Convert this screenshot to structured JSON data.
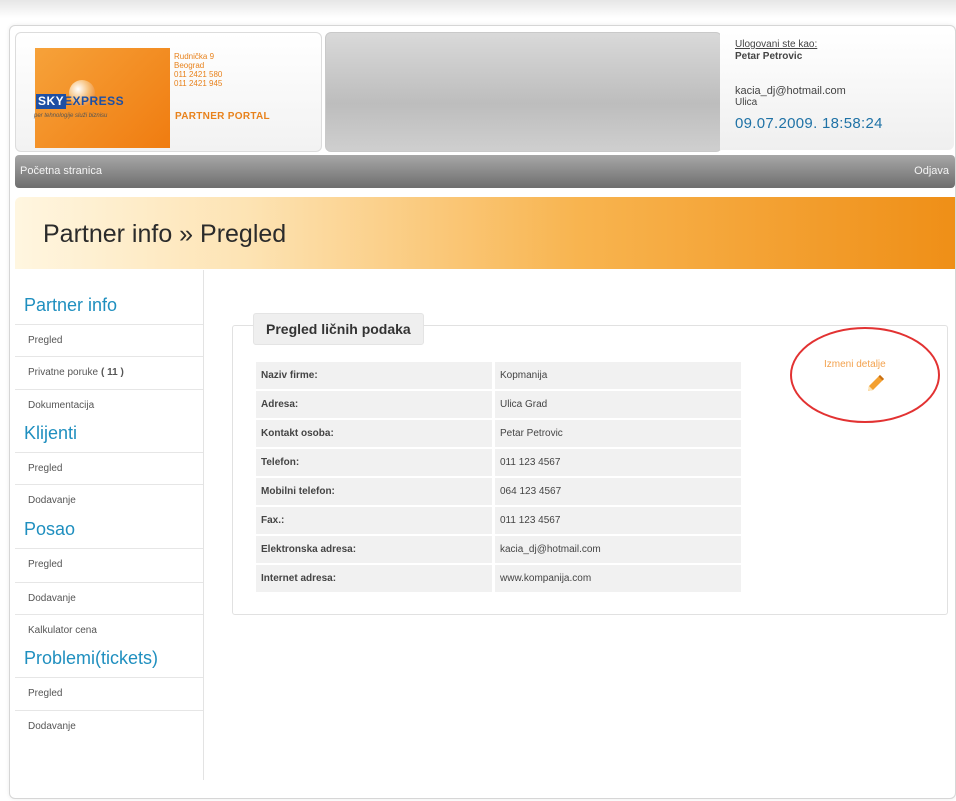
{
  "header": {
    "logo": {
      "sky": "SKY",
      "express": "EXPRESS",
      "tagline": "per tehnologije služi biznisu"
    },
    "contact": [
      "Rudnička 9",
      "Beograd",
      "011 2421 580",
      "011 2421 945"
    ],
    "portal_title": "PARTNER PORTAL",
    "user": {
      "label": "Ulogovani ste kao:",
      "name": "Petar Petrovic",
      "email": "kacia_dj@hotmail.com",
      "street": "Ulica",
      "datetime": "09.07.2009. 18:58:24"
    }
  },
  "nav": {
    "home": "Početna stranica",
    "logout": "Odjava"
  },
  "page_title": "Partner info » Pregled",
  "sidebar": {
    "sections": [
      {
        "title": "Partner info",
        "items": [
          {
            "label": "Pregled"
          },
          {
            "label": "Privatne poruke",
            "count": "( 11 )"
          },
          {
            "label": "Dokumentacija"
          }
        ]
      },
      {
        "title": "Klijenti",
        "items": [
          {
            "label": "Pregled"
          },
          {
            "label": "Dodavanje"
          }
        ]
      },
      {
        "title": "Posao",
        "items": [
          {
            "label": "Pregled"
          },
          {
            "label": "Dodavanje"
          },
          {
            "label": "Kalkulator cena"
          }
        ]
      },
      {
        "title": "Problemi(tickets)",
        "items": [
          {
            "label": "Pregled"
          },
          {
            "label": "Dodavanje"
          }
        ]
      }
    ]
  },
  "main": {
    "section_title": "Pregled ličnih podaka",
    "edit_label": "Izmeni detalje",
    "fields": [
      {
        "key": "Naziv firme:",
        "value": "Kopmanija"
      },
      {
        "key": "Adresa:",
        "value": "Ulica Grad"
      },
      {
        "key": "Kontakt osoba:",
        "value": "Petar Petrovic"
      },
      {
        "key": "Telefon:",
        "value": "011 123 4567"
      },
      {
        "key": "Mobilni telefon:",
        "value": "064 123 4567"
      },
      {
        "key": "Fax.:",
        "value": "011 123 4567"
      },
      {
        "key": "Elektronska adresa:",
        "value": "kacia_dj@hotmail.com"
      },
      {
        "key": "Internet adresa:",
        "value": "www.kompanija.com"
      }
    ]
  },
  "colors": {
    "accent_orange": "#ef8f17",
    "link_blue": "#1f8fbf",
    "annotation_red": "#e23232"
  },
  "icons": {
    "edit": "pencil-icon"
  }
}
